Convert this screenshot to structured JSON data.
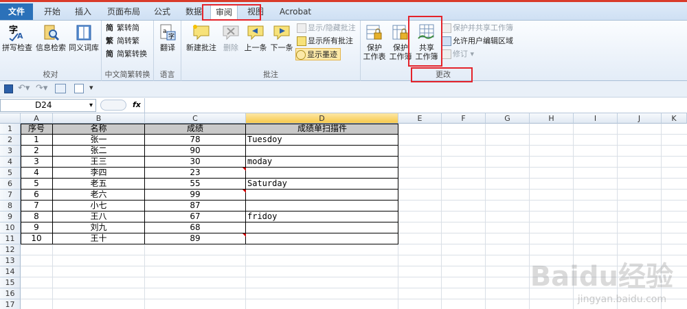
{
  "tabs": [
    {
      "label": "文件"
    },
    {
      "label": "开始"
    },
    {
      "label": "插入"
    },
    {
      "label": "页面布局"
    },
    {
      "label": "公式"
    },
    {
      "label": "数据"
    },
    {
      "label": "审阅"
    },
    {
      "label": "视图"
    },
    {
      "label": "Acrobat"
    }
  ],
  "ribbon": {
    "proofing": {
      "label": "校对",
      "spell": "拼写检查",
      "research": "信息检索",
      "thesaurus": "同义词库"
    },
    "chinese": {
      "label": "中文简繁转换",
      "to_simplified": "繁转简",
      "to_traditional": "简转繁",
      "convert": "简繁转换"
    },
    "language": {
      "label": "语言",
      "translate": "翻译"
    },
    "comments": {
      "label": "批注",
      "new": "新建批注",
      "delete": "删除",
      "prev": "上一条",
      "next": "下一条",
      "show_hide": "显示/隐藏批注",
      "show_all": "显示所有批注",
      "show_ink": "显示墨迹"
    },
    "changes": {
      "label": "更改",
      "protect_sheet_l1": "保护",
      "protect_sheet_l2": "工作表",
      "protect_wb_l1": "保护",
      "protect_wb_l2": "工作簿",
      "share_l1": "共享",
      "share_l2": "工作簿",
      "protect_share": "保护并共享工作簿",
      "allow_edit": "允许用户编辑区域",
      "track": "修订"
    }
  },
  "namebox": "D24",
  "fx": "fx",
  "columns": [
    "A",
    "B",
    "C",
    "D",
    "E",
    "F",
    "G",
    "H",
    "I",
    "J",
    "K"
  ],
  "rows": [
    "1",
    "2",
    "3",
    "4",
    "5",
    "6",
    "7",
    "8",
    "9",
    "10",
    "11",
    "12",
    "13",
    "14",
    "15",
    "16",
    "17"
  ],
  "table": {
    "headers": [
      "序号",
      "名称",
      "成绩",
      "成绩单扫描件"
    ],
    "data": [
      [
        "1",
        "张一",
        "78",
        "Tuesdoy"
      ],
      [
        "2",
        "张二",
        "90",
        ""
      ],
      [
        "3",
        "王三",
        "30",
        "moday"
      ],
      [
        "4",
        "李四",
        "23",
        ""
      ],
      [
        "5",
        "老五",
        "55",
        "Saturday"
      ],
      [
        "6",
        "老六",
        "99",
        ""
      ],
      [
        "7",
        "小七",
        "87",
        ""
      ],
      [
        "8",
        "王八",
        "67",
        "fridoy"
      ],
      [
        "9",
        "刘九",
        "68",
        ""
      ],
      [
        "10",
        "王十",
        "89",
        ""
      ]
    ]
  },
  "watermark": "Baidu经验",
  "watermark_url": "jingyan.baidu.com",
  "colors": {
    "accent": "#2b71b9",
    "highlight": "#e4222a",
    "selected_col": "#f7c94b"
  }
}
